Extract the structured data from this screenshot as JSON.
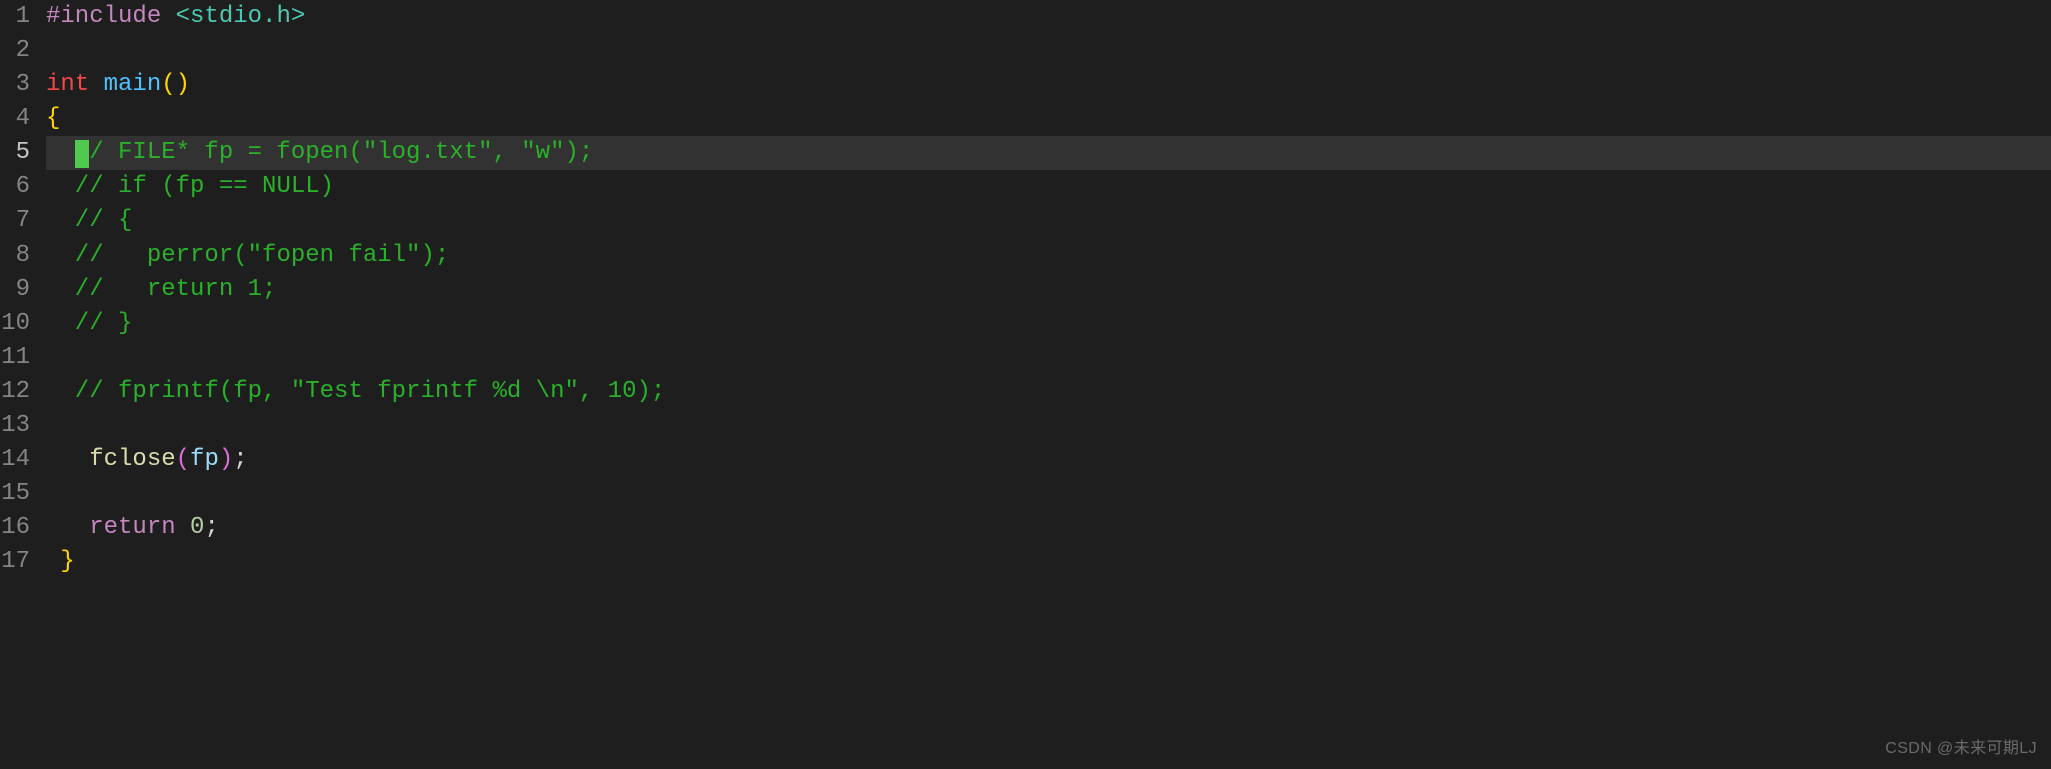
{
  "lineNumbers": [
    "1",
    "2",
    "3",
    "4",
    "5",
    "6",
    "7",
    "8",
    "9",
    "10",
    "11",
    "12",
    "13",
    "14",
    "15",
    "16",
    "17"
  ],
  "activeLine": 5,
  "code": {
    "l1_include": "#include",
    "l1_header": " <stdio.h>",
    "l3_int": "int",
    "l3_main": " main",
    "l3_par_o": "(",
    "l3_par_c": ")",
    "l4_brace": "{",
    "l5_indent": "  ",
    "l5_rest": "/ FILE* fp = fopen(\"log.txt\", \"w\");",
    "l6": "  // if (fp == NULL)",
    "l7": "  // {",
    "l8": "  //   perror(\"fopen fail\");",
    "l9": "  //   return 1;",
    "l10": "  // }",
    "l12": "  // fprintf(fp, \"Test fprintf %d \\n\", 10);",
    "l14_indent": "   ",
    "l14_fclose": "fclose",
    "l14_po": "(",
    "l14_fp": "fp",
    "l14_pc": ")",
    "l14_semi": ";",
    "l16_indent": "   ",
    "l16_return": "return",
    "l16_sp": " ",
    "l16_zero": "0",
    "l16_semi": ";",
    "l17_indent": " ",
    "l17_brace": "}"
  },
  "watermark": "CSDN @未来可期LJ"
}
